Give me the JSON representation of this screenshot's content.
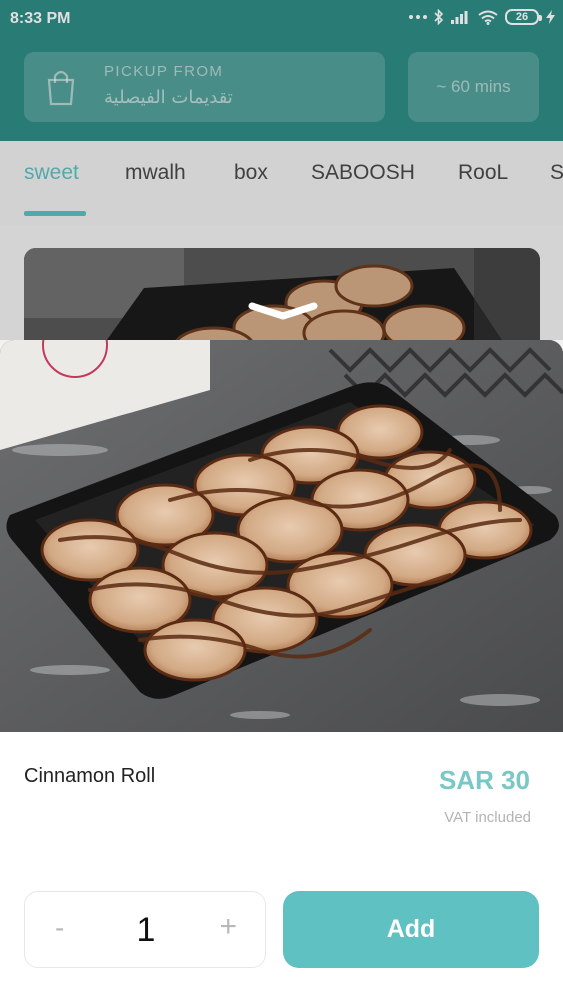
{
  "status_bar": {
    "time": "8:33 PM",
    "battery": "26",
    "icons": [
      "more-dots-icon",
      "bluetooth-icon",
      "cellular-signal-icon",
      "wifi-icon",
      "battery-icon",
      "charging-bolt-icon"
    ]
  },
  "header": {
    "pickup_label": "PICKUP FROM",
    "pickup_location": "تقديمات الفيصلية",
    "eta": "~ 60 mins",
    "icon": "shopping-bag-icon"
  },
  "tabs": {
    "items": [
      {
        "label": "sweet",
        "active": true
      },
      {
        "label": "mwalh",
        "active": false
      },
      {
        "label": "box",
        "active": false
      },
      {
        "label": "SABOOSH",
        "active": false
      },
      {
        "label": "RooL",
        "active": false
      },
      {
        "label": "S",
        "active": false
      }
    ]
  },
  "product": {
    "name": "Cinnamon Roll",
    "price": "SAR 30",
    "vat_note": "VAT included",
    "image": "cinnamon-rolls-tray-photo"
  },
  "actions": {
    "minus": "-",
    "quantity": "1",
    "plus": "+",
    "add_label": "Add"
  },
  "colors": {
    "header_teal": "#2f8d87",
    "accent": "#5fc1c1",
    "price": "#79c8c6"
  }
}
